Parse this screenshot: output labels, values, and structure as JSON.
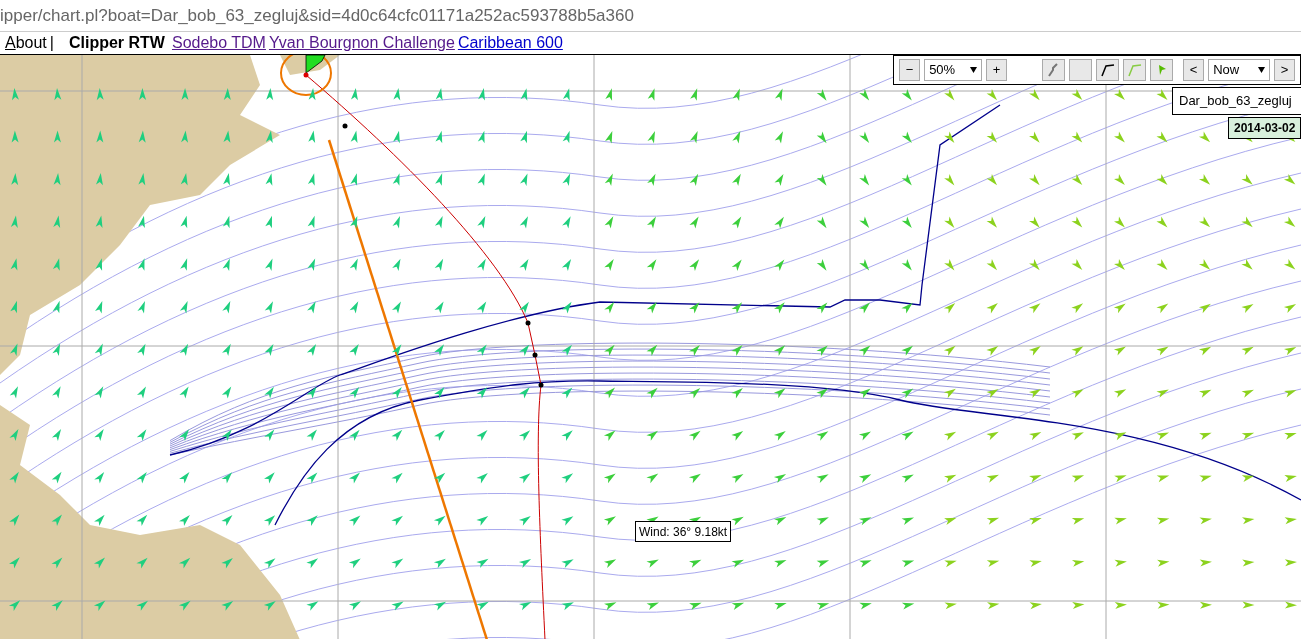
{
  "address_bar": {
    "url": "ipper/chart.pl?boat=Dar_bob_63_zegluj&sid=4d0c64cfc01171a252ac593788b5a360"
  },
  "nav": {
    "items": [
      {
        "label": "About",
        "kind": "plain"
      },
      {
        "label": "|",
        "kind": "separator"
      },
      {
        "label": "Clipper RTW",
        "kind": "current"
      },
      {
        "label": "Sodebo TDM",
        "kind": "link",
        "visited": true
      },
      {
        "label": "Yvan Bourgnon Challenge",
        "kind": "link",
        "visited": true
      },
      {
        "label": "Caribbean 600",
        "kind": "link",
        "visited": false
      }
    ]
  },
  "toolbar": {
    "zoom_out": "−",
    "zoom": "50%",
    "zoom_in": "+",
    "prev": "<",
    "time": "Now",
    "next": ">"
  },
  "boat_label": "Dar_bob_63_zegluj",
  "date_label": "2014-03-02",
  "wind_tooltip": "Wind: 36° 9.18kt"
}
